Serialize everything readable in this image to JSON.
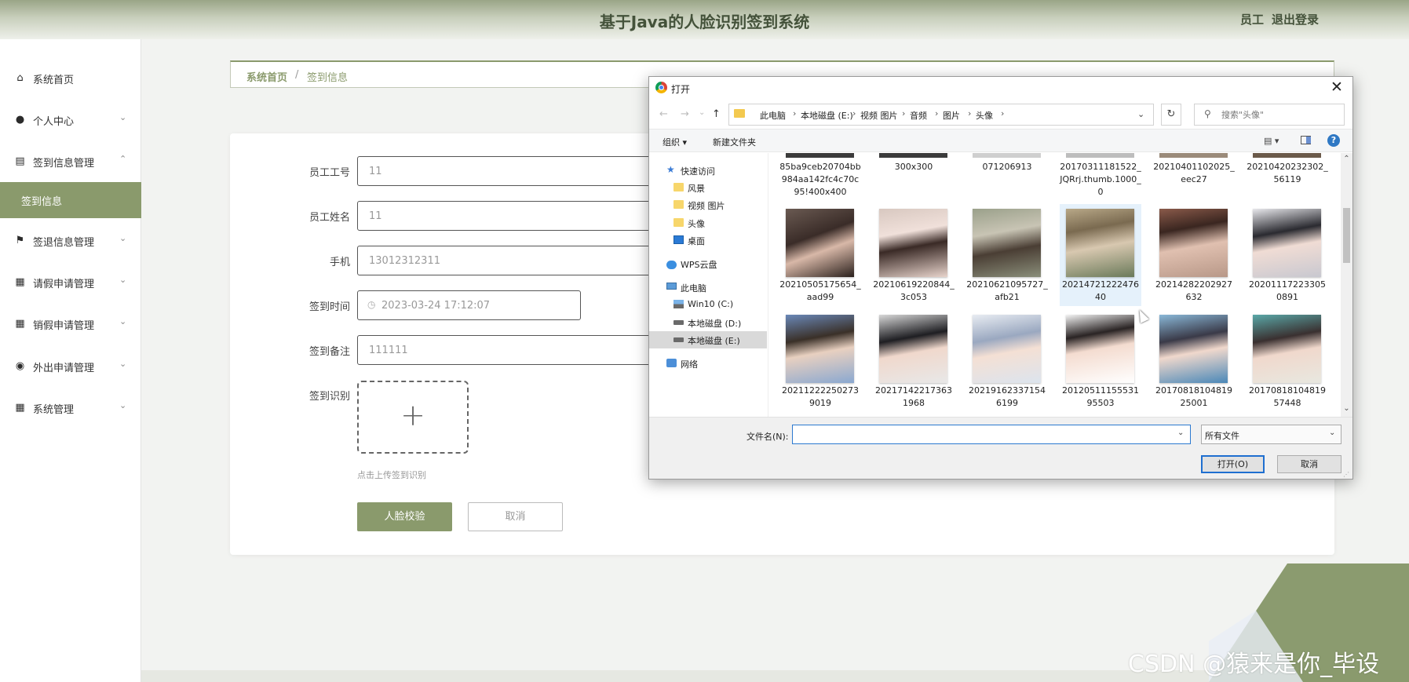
{
  "header": {
    "title": "基于Java的人脸识别签到系统",
    "role": "员工",
    "logout": "退出登录"
  },
  "sidebar": {
    "items": [
      {
        "label": "系统首页",
        "icon": "home-icon",
        "glyph": "⌂",
        "arrow": ""
      },
      {
        "label": "个人中心",
        "icon": "user-icon",
        "glyph": "●",
        "arrow": "⌄"
      },
      {
        "label": "签到信息管理",
        "icon": "clipboard-icon",
        "glyph": "▤",
        "arrow": "⌃"
      },
      {
        "label": "签到信息",
        "icon": "",
        "glyph": "",
        "arrow": ""
      },
      {
        "label": "签退信息管理",
        "icon": "flag-icon",
        "glyph": "⚑",
        "arrow": "⌄"
      },
      {
        "label": "请假申请管理",
        "icon": "grid-icon",
        "glyph": "▦",
        "arrow": "⌄"
      },
      {
        "label": "销假申请管理",
        "icon": "grid-icon",
        "glyph": "▦",
        "arrow": "⌄"
      },
      {
        "label": "外出申请管理",
        "icon": "location-icon",
        "glyph": "◉",
        "arrow": "⌄"
      },
      {
        "label": "系统管理",
        "icon": "grid-icon",
        "glyph": "▦",
        "arrow": "⌄"
      }
    ]
  },
  "breadcrumb": {
    "home": "系统首页",
    "sep": "/",
    "current": "签到信息"
  },
  "form": {
    "fields": [
      {
        "label": "员工工号",
        "value": "11"
      },
      {
        "label": "员工姓名",
        "value": "11"
      },
      {
        "label": "手机",
        "value": "13012312311"
      },
      {
        "label": "签到时间",
        "value": "2023-03-24 17:12:07"
      },
      {
        "label": "签到备注",
        "value": "111111"
      }
    ],
    "upload_label": "签到识别",
    "upload_plus": "+",
    "upload_tip": "点击上传签到识别",
    "submit": "人脸校验",
    "cancel": "取消"
  },
  "dialog": {
    "title": "打开",
    "close": "✕",
    "nav": {
      "back": "←",
      "forward": "→",
      "recent": "⌄",
      "up": "↑",
      "refresh": "↻"
    },
    "address": [
      "此电脑",
      "本地磁盘 (E:)",
      "视频 图片",
      "音频",
      "图片",
      "头像"
    ],
    "address_sep": "›",
    "search_placeholder": "搜索\"头像\"",
    "search_glyph": "⚲",
    "commands": {
      "organize": "组织 ▾",
      "new_folder": "新建文件夹",
      "view": "▤ ▾",
      "help": "?"
    },
    "tree": [
      {
        "label": "快速访问",
        "kind": "star",
        "indent": 1
      },
      {
        "label": "风景",
        "kind": "folder",
        "indent": 2
      },
      {
        "label": "视频 图片",
        "kind": "folder",
        "indent": 2
      },
      {
        "label": "头像",
        "kind": "folder",
        "indent": 2
      },
      {
        "label": "桌面",
        "kind": "desktop",
        "indent": 2
      },
      {
        "label": "WPS云盘",
        "kind": "cloud",
        "indent": 1
      },
      {
        "label": "此电脑",
        "kind": "pc",
        "indent": 1
      },
      {
        "label": "Win10 (C:)",
        "kind": "winDrive",
        "indent": 2
      },
      {
        "label": "本地磁盘 (D:)",
        "kind": "drive",
        "indent": 2
      },
      {
        "label": "本地磁盘 (E:)",
        "kind": "drive",
        "indent": 2
      },
      {
        "label": "网络",
        "kind": "network",
        "indent": 1
      }
    ],
    "files_row0": [
      "85ba9ceb20704bb984aa142fc4c70c95!400x400",
      "300x300",
      "071206913",
      "20170311181522_JQRrj.thumb.1000_0",
      "20210401102025_eec27",
      "20210420232302_56119"
    ],
    "files_row1": [
      "20210505175654_aad99",
      "20210619220844_3c053",
      "20210621095727_afb21",
      "2021472122247640",
      "20214282202927632",
      "202011172233050891"
    ],
    "files_row2": [
      "202112222502739019",
      "202171422173631968",
      "202191623371546199",
      "2012051115553195503",
      "2017081810481925001",
      "2017081810481957448"
    ],
    "scroll": {
      "up": "⌃",
      "down": "⌄"
    },
    "filename_label": "文件名(N):",
    "filename_value": "",
    "dropdown_glyph": "⌄",
    "filetype": "所有文件",
    "open_button": "打开(O)",
    "cancel_button": "取消",
    "grip": "⋰"
  },
  "watermark": "CSDN @猿来是你_毕设"
}
